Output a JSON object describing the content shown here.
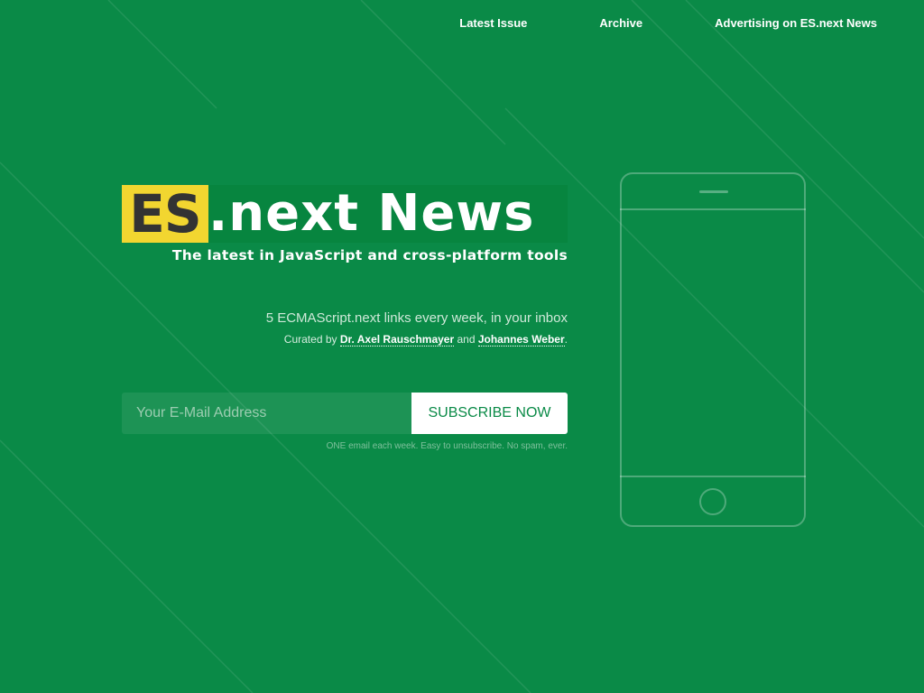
{
  "nav": {
    "latest_issue": "Latest Issue",
    "archive": "Archive",
    "advertising": "Advertising on ES.next News"
  },
  "logo": {
    "highlight": "ES",
    "rest": ".next News"
  },
  "tagline": "The latest in JavaScript and cross-platform tools",
  "intro": {
    "links_line": "5 ECMAScript.next links every week, in your inbox",
    "curated_prefix": "Curated by ",
    "curator_1": "Dr. Axel Rauschmayer",
    "curated_and": " and ",
    "curator_2": "Johannes Weber",
    "curated_suffix": "."
  },
  "form": {
    "email_placeholder": "Your E-Mail Address",
    "email_value": "",
    "subscribe_label": "SUBSCRIBE NOW",
    "fineprint": "ONE email each week. Easy to unsubscribe. No spam, ever."
  },
  "colors": {
    "background": "#0a8a47",
    "logo_highlight": "#f2d630",
    "logo_text_dark": "#333333",
    "button_bg": "#ffffff",
    "button_text": "#0a8a47"
  },
  "illustration": {
    "icon": "smartphone-outline-icon"
  }
}
